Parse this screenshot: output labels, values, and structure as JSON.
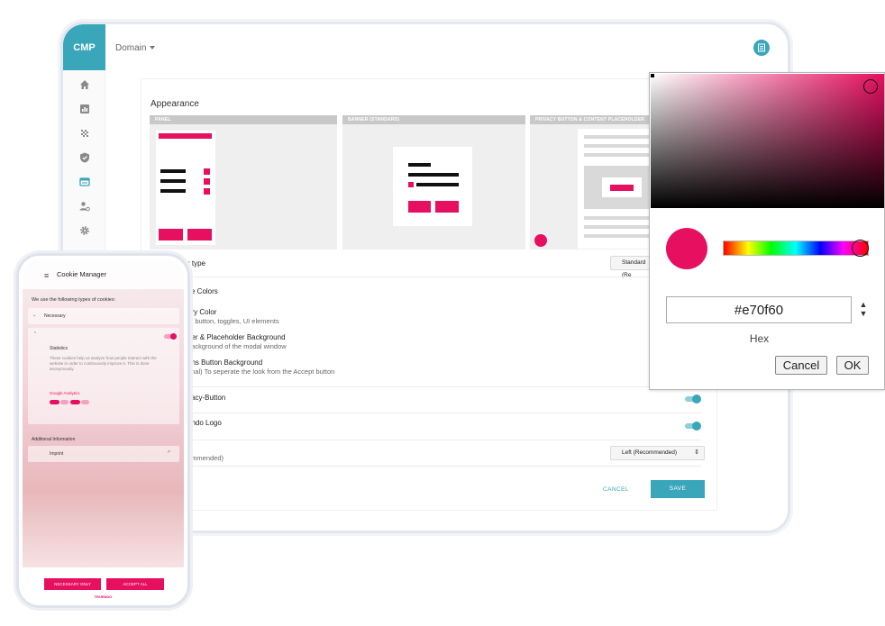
{
  "app": {
    "logo": "CMP",
    "domain_label": "Domain",
    "top_right_icon": "document-icon",
    "nav_icons": [
      "home-icon",
      "chart-icon",
      "grid-icon",
      "shield-icon",
      "window-icon",
      "user-settings-icon",
      "gear-icon"
    ]
  },
  "appearance": {
    "title": "Appearance",
    "previews": [
      {
        "label": "PANEL"
      },
      {
        "label": "BANNER (STANDARD)"
      },
      {
        "label": "PRIVACY BUTTON & CONTENT PLACEHOLDER"
      }
    ],
    "banner_type_label": "r type",
    "banner_type_value": "Standard (Re",
    "custom_colors_label": "ze Colors",
    "primary_label": "ary Color",
    "primary_sub": "pt button, toggles, UI elements",
    "banner_bg_label": "ner & Placeholder Background",
    "banner_bg_sub": "background of the modal window",
    "options_bg_label": "ons Button Background",
    "options_bg_sub": "onal) To seperate the look from the Accept button",
    "privacy_button_label": "vacy-Button",
    "logo_label": "endo Logo",
    "position_label": "e",
    "position_sub": "ommended)",
    "position_value": "Left (Recommended)",
    "cancel": "CANCEL",
    "save": "SAVE",
    "accent": "#3aa6b9"
  },
  "picker": {
    "hex_value": "#e70f60",
    "format_label": "Hex",
    "cancel": "Cancel",
    "ok": "OK",
    "color": "#e70f60"
  },
  "phone": {
    "title": "Cookie Manager",
    "intro": "We use the following types of cookies:",
    "necessary": "Necessary",
    "statistics": "Statistics",
    "statistics_desc": "These cookies help us analyze how people interact with the website in order to continuously improve it. This is done anonymously.",
    "google_analytics": "Google Analytics",
    "additional": "Additional Information",
    "imprint": "Imprint",
    "necessary_only": "NECESSARY ONLY",
    "accept_all": "ACCEPT ALL",
    "brand": "TRUENDO"
  }
}
